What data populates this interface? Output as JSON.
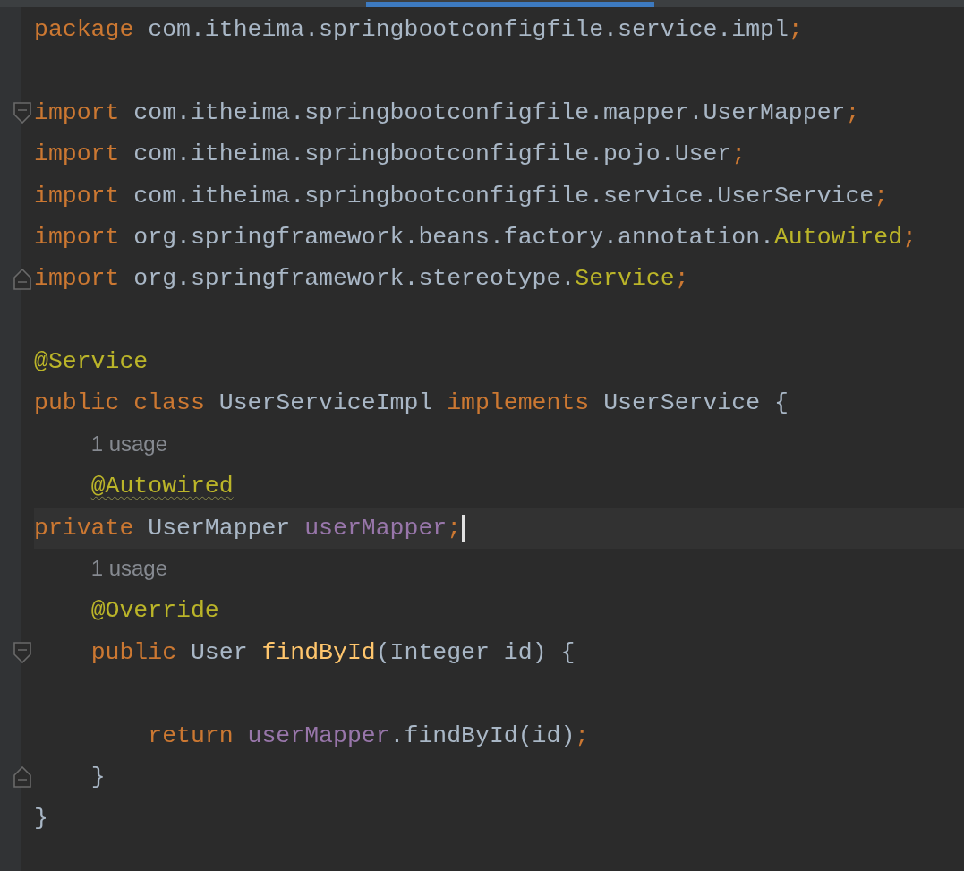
{
  "editor": {
    "lines": [
      {
        "kind": "code",
        "fold_start": false,
        "fold_end": false,
        "caret": false,
        "tokens": [
          {
            "kind": "keyword",
            "text": "package"
          },
          {
            "kind": "plain",
            "text": " com.itheima.springbootconfigfile.service.impl"
          },
          {
            "kind": "keyword",
            "text": ";"
          }
        ]
      },
      {
        "kind": "blank",
        "fold_start": false,
        "fold_end": false,
        "caret": false
      },
      {
        "kind": "code",
        "fold_start": true,
        "fold_end": false,
        "caret": false,
        "tokens": [
          {
            "kind": "keyword",
            "text": "import"
          },
          {
            "kind": "plain",
            "text": " com.itheima.springbootconfigfile.mapper.UserMapper"
          },
          {
            "kind": "keyword",
            "text": ";"
          }
        ]
      },
      {
        "kind": "code",
        "fold_start": false,
        "fold_end": false,
        "caret": false,
        "tokens": [
          {
            "kind": "keyword",
            "text": "import"
          },
          {
            "kind": "plain",
            "text": " com.itheima.springbootconfigfile.pojo.User"
          },
          {
            "kind": "keyword",
            "text": ";"
          }
        ]
      },
      {
        "kind": "code",
        "fold_start": false,
        "fold_end": false,
        "caret": false,
        "tokens": [
          {
            "kind": "keyword",
            "text": "import"
          },
          {
            "kind": "plain",
            "text": " com.itheima.springbootconfigfile.service.UserService"
          },
          {
            "kind": "keyword",
            "text": ";"
          }
        ]
      },
      {
        "kind": "code",
        "fold_start": false,
        "fold_end": false,
        "caret": false,
        "tokens": [
          {
            "kind": "keyword",
            "text": "import"
          },
          {
            "kind": "plain",
            "text": " org.springframework.beans.factory.annotation."
          },
          {
            "kind": "annotation",
            "text": "Autowired"
          },
          {
            "kind": "keyword",
            "text": ";"
          }
        ]
      },
      {
        "kind": "code",
        "fold_start": false,
        "fold_end": true,
        "caret": false,
        "tokens": [
          {
            "kind": "keyword",
            "text": "import"
          },
          {
            "kind": "plain",
            "text": " org.springframework.stereotype."
          },
          {
            "kind": "annotation",
            "text": "Service"
          },
          {
            "kind": "keyword",
            "text": ";"
          }
        ]
      },
      {
        "kind": "blank",
        "fold_start": false,
        "fold_end": false,
        "caret": false
      },
      {
        "kind": "code",
        "fold_start": false,
        "fold_end": false,
        "caret": false,
        "tokens": [
          {
            "kind": "annotation",
            "text": "@Service"
          }
        ]
      },
      {
        "kind": "code",
        "fold_start": false,
        "fold_end": false,
        "caret": false,
        "tokens": [
          {
            "kind": "keyword",
            "text": "public class"
          },
          {
            "kind": "plain",
            "text": " UserServiceImpl "
          },
          {
            "kind": "keyword",
            "text": "implements"
          },
          {
            "kind": "plain",
            "text": " UserService {"
          }
        ]
      },
      {
        "kind": "hint",
        "fold_start": false,
        "fold_end": false,
        "caret": false,
        "tokens": [
          {
            "kind": "hint",
            "text": "    1 usage"
          }
        ]
      },
      {
        "kind": "code",
        "fold_start": false,
        "fold_end": false,
        "caret": false,
        "tokens": [
          {
            "kind": "annotation",
            "text": "    @Autowired",
            "warning": true
          }
        ]
      },
      {
        "kind": "code",
        "fold_start": false,
        "fold_end": false,
        "current": true,
        "caret": true,
        "tokens": [
          {
            "kind": "keyword",
            "text": "private"
          },
          {
            "kind": "plain",
            "text": " UserMapper "
          },
          {
            "kind": "field",
            "text": "userMapper"
          },
          {
            "kind": "keyword",
            "text": ";"
          }
        ]
      },
      {
        "kind": "hint",
        "fold_start": false,
        "fold_end": false,
        "caret": false,
        "tokens": [
          {
            "kind": "hint",
            "text": "    1 usage"
          }
        ]
      },
      {
        "kind": "code",
        "fold_start": false,
        "fold_end": false,
        "caret": false,
        "tokens": [
          {
            "kind": "annotation",
            "text": "    @Override"
          }
        ]
      },
      {
        "kind": "code",
        "fold_start": true,
        "fold_end": false,
        "caret": false,
        "tokens": [
          {
            "kind": "keyword",
            "text": "    public"
          },
          {
            "kind": "plain",
            "text": " User "
          },
          {
            "kind": "method",
            "text": "findById"
          },
          {
            "kind": "plain",
            "text": "(Integer id) {"
          }
        ]
      },
      {
        "kind": "blank",
        "fold_start": false,
        "fold_end": false,
        "caret": false
      },
      {
        "kind": "code",
        "fold_start": false,
        "fold_end": false,
        "caret": false,
        "tokens": [
          {
            "kind": "keyword",
            "text": "        return"
          },
          {
            "kind": "field",
            "text": " userMapper"
          },
          {
            "kind": "plain",
            "text": ".findById(id)"
          },
          {
            "kind": "keyword",
            "text": ";"
          }
        ]
      },
      {
        "kind": "code",
        "fold_start": false,
        "fold_end": true,
        "caret": false,
        "tokens": [
          {
            "kind": "plain",
            "text": "    }"
          }
        ]
      },
      {
        "kind": "code",
        "fold_start": false,
        "fold_end": false,
        "caret": false,
        "tokens": [
          {
            "kind": "plain",
            "text": "}"
          }
        ]
      }
    ]
  }
}
